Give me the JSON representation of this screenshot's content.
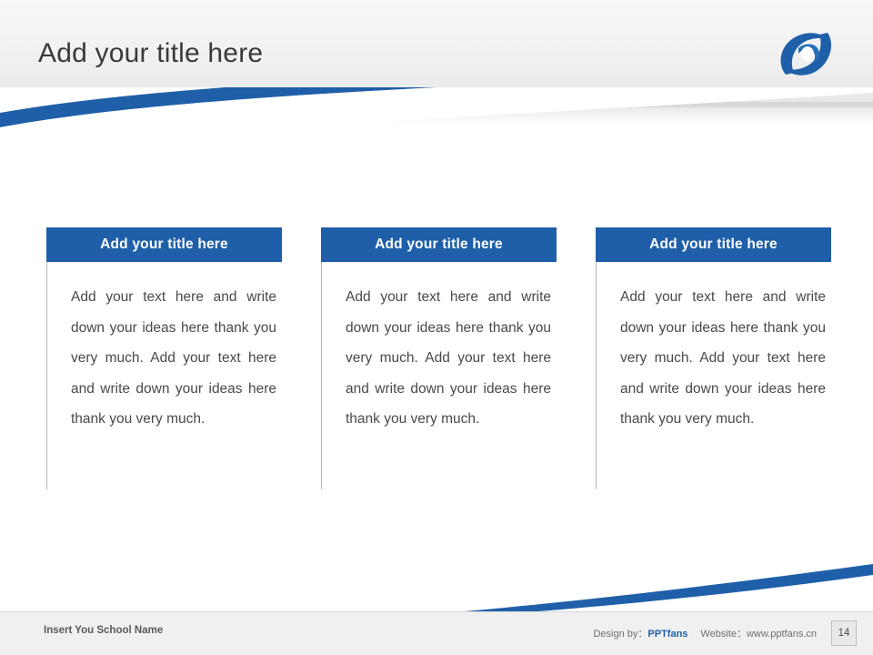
{
  "slide": {
    "title": "Add your title here",
    "logo_icon": "swirl-logo-icon",
    "columns": [
      {
        "heading": "Add your title here",
        "body": "Add your text here and write down your ideas here thank you very much. Add your text here and write down your ideas here thank you very much."
      },
      {
        "heading": "Add your title here",
        "body": "Add your text here and write down your ideas here thank you very much. Add your text here and write down your ideas here thank you very much."
      },
      {
        "heading": "Add your title here",
        "body": "Add your text here and write down your ideas here thank you very much. Add your text here and write down your ideas here thank you very much."
      }
    ]
  },
  "footer": {
    "school_name": "Insert You School Name",
    "design_by_label": "Design by：",
    "design_by_value": "PPTfans",
    "website_label": "Website：",
    "website_value": "www.pptfans.cn",
    "page_number": "14"
  },
  "colors": {
    "accent": "#1f5fa9",
    "title_text": "#3a3a3a",
    "body_text": "#4a4a4a"
  }
}
